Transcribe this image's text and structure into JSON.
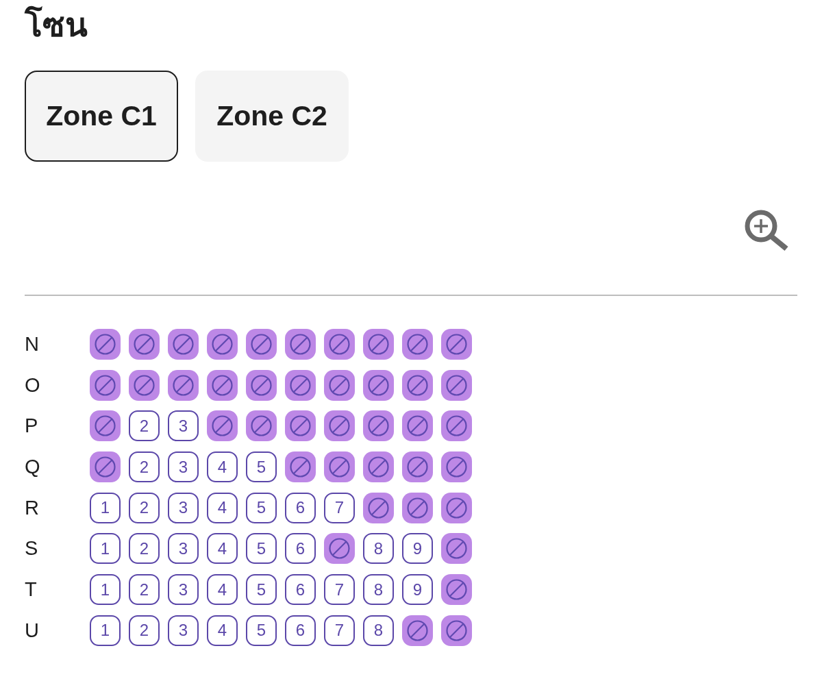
{
  "title": "โซน",
  "zones": [
    {
      "label": "Zone C1",
      "selected": true
    },
    {
      "label": "Zone C2",
      "selected": false
    }
  ],
  "rows": [
    {
      "label": "N",
      "seats": [
        {
          "available": false
        },
        {
          "available": false
        },
        {
          "available": false
        },
        {
          "available": false
        },
        {
          "available": false
        },
        {
          "available": false
        },
        {
          "available": false
        },
        {
          "available": false
        },
        {
          "available": false
        },
        {
          "available": false
        }
      ]
    },
    {
      "label": "O",
      "seats": [
        {
          "available": false
        },
        {
          "available": false
        },
        {
          "available": false
        },
        {
          "available": false
        },
        {
          "available": false
        },
        {
          "available": false
        },
        {
          "available": false
        },
        {
          "available": false
        },
        {
          "available": false
        },
        {
          "available": false
        }
      ]
    },
    {
      "label": "P",
      "seats": [
        {
          "available": false
        },
        {
          "available": true,
          "number": "2"
        },
        {
          "available": true,
          "number": "3"
        },
        {
          "available": false
        },
        {
          "available": false
        },
        {
          "available": false
        },
        {
          "available": false
        },
        {
          "available": false
        },
        {
          "available": false
        },
        {
          "available": false
        }
      ]
    },
    {
      "label": "Q",
      "seats": [
        {
          "available": false
        },
        {
          "available": true,
          "number": "2"
        },
        {
          "available": true,
          "number": "3"
        },
        {
          "available": true,
          "number": "4"
        },
        {
          "available": true,
          "number": "5"
        },
        {
          "available": false
        },
        {
          "available": false
        },
        {
          "available": false
        },
        {
          "available": false
        },
        {
          "available": false
        }
      ]
    },
    {
      "label": "R",
      "seats": [
        {
          "available": true,
          "number": "1"
        },
        {
          "available": true,
          "number": "2"
        },
        {
          "available": true,
          "number": "3"
        },
        {
          "available": true,
          "number": "4"
        },
        {
          "available": true,
          "number": "5"
        },
        {
          "available": true,
          "number": "6"
        },
        {
          "available": true,
          "number": "7"
        },
        {
          "available": false
        },
        {
          "available": false
        },
        {
          "available": false
        }
      ]
    },
    {
      "label": "S",
      "seats": [
        {
          "available": true,
          "number": "1"
        },
        {
          "available": true,
          "number": "2"
        },
        {
          "available": true,
          "number": "3"
        },
        {
          "available": true,
          "number": "4"
        },
        {
          "available": true,
          "number": "5"
        },
        {
          "available": true,
          "number": "6"
        },
        {
          "available": false
        },
        {
          "available": true,
          "number": "8"
        },
        {
          "available": true,
          "number": "9"
        },
        {
          "available": false
        }
      ]
    },
    {
      "label": "T",
      "seats": [
        {
          "available": true,
          "number": "1"
        },
        {
          "available": true,
          "number": "2"
        },
        {
          "available": true,
          "number": "3"
        },
        {
          "available": true,
          "number": "4"
        },
        {
          "available": true,
          "number": "5"
        },
        {
          "available": true,
          "number": "6"
        },
        {
          "available": true,
          "number": "7"
        },
        {
          "available": true,
          "number": "8"
        },
        {
          "available": true,
          "number": "9"
        },
        {
          "available": false
        }
      ]
    },
    {
      "label": "U",
      "seats": [
        {
          "available": true,
          "number": "1"
        },
        {
          "available": true,
          "number": "2"
        },
        {
          "available": true,
          "number": "3"
        },
        {
          "available": true,
          "number": "4"
        },
        {
          "available": true,
          "number": "5"
        },
        {
          "available": true,
          "number": "6"
        },
        {
          "available": true,
          "number": "7"
        },
        {
          "available": true,
          "number": "8"
        },
        {
          "available": false
        },
        {
          "available": false
        }
      ]
    }
  ]
}
